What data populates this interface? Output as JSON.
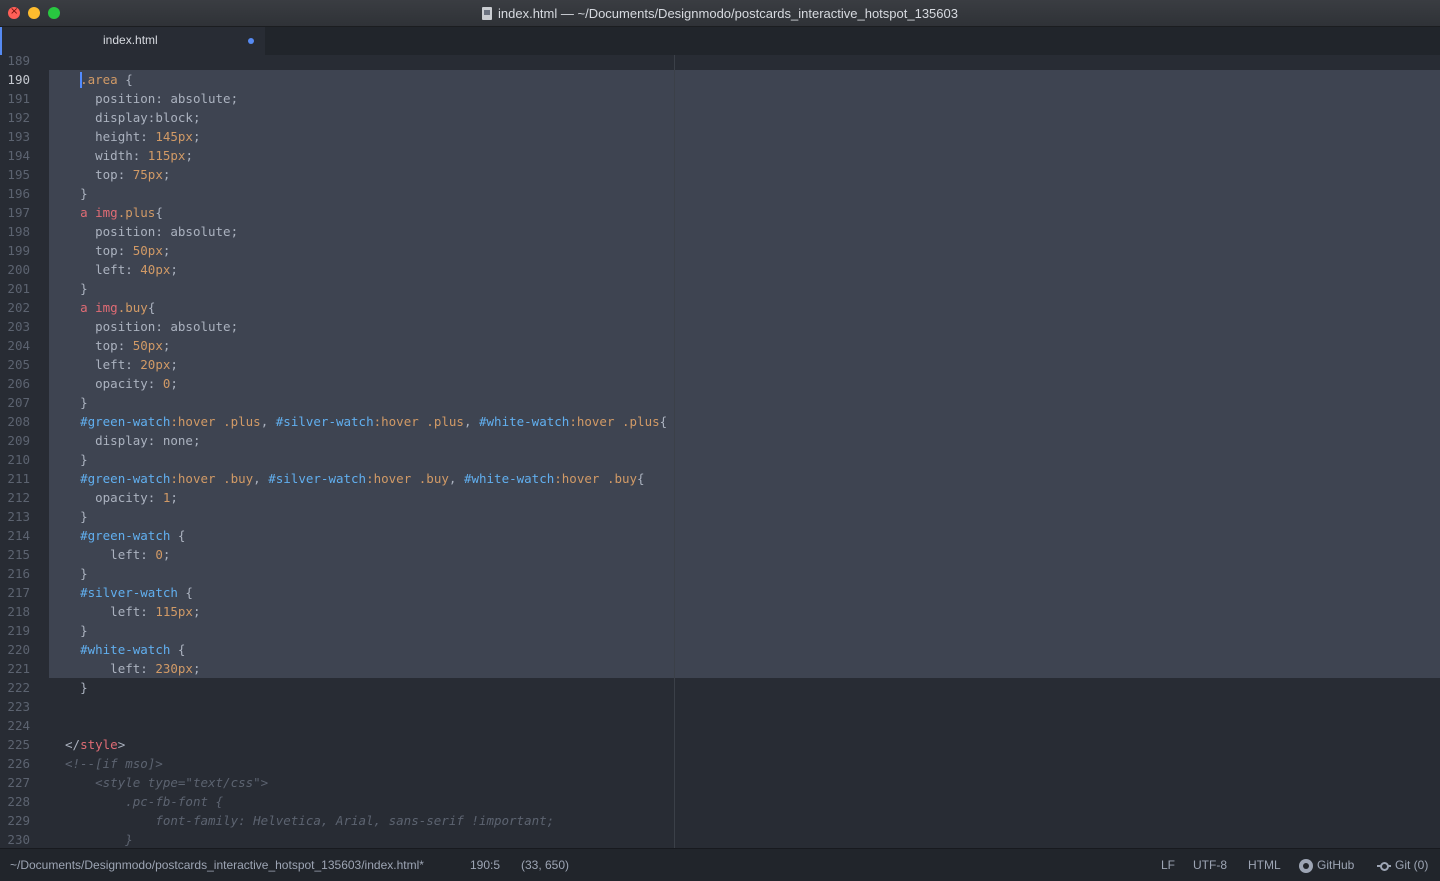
{
  "window": {
    "title": "index.html — ~/Documents/Designmodo/postcards_interactive_hotspot_135603"
  },
  "tab": {
    "label": "index.html"
  },
  "editor": {
    "lines": [
      {
        "n": "189",
        "tokens": []
      },
      {
        "n": "190",
        "tokens": [
          {
            "t": ".area",
            "c": "t-c"
          },
          {
            "t": " {",
            "c": "t-p"
          }
        ]
      },
      {
        "n": "191",
        "tokens": [
          {
            "t": "  position: absolute;",
            "c": "t-p"
          }
        ]
      },
      {
        "n": "192",
        "tokens": [
          {
            "t": "  display:block;",
            "c": "t-p"
          }
        ]
      },
      {
        "n": "193",
        "tokens": [
          {
            "t": "  height: ",
            "c": "t-p"
          },
          {
            "t": "145px",
            "c": "t-n"
          },
          {
            "t": ";",
            "c": "t-p"
          }
        ]
      },
      {
        "n": "194",
        "tokens": [
          {
            "t": "  width: ",
            "c": "t-p"
          },
          {
            "t": "115px",
            "c": "t-n"
          },
          {
            "t": ";",
            "c": "t-p"
          }
        ]
      },
      {
        "n": "195",
        "tokens": [
          {
            "t": "  top: ",
            "c": "t-p"
          },
          {
            "t": "75px",
            "c": "t-n"
          },
          {
            "t": ";",
            "c": "t-p"
          }
        ]
      },
      {
        "n": "196",
        "tokens": [
          {
            "t": "}",
            "c": "t-p"
          }
        ]
      },
      {
        "n": "197",
        "tokens": [
          {
            "t": "a ",
            "c": "t-k"
          },
          {
            "t": "img",
            "c": "t-k"
          },
          {
            "t": ".plus",
            "c": "t-c"
          },
          {
            "t": "{",
            "c": "t-p"
          }
        ]
      },
      {
        "n": "198",
        "tokens": [
          {
            "t": "  position: absolute;",
            "c": "t-p"
          }
        ]
      },
      {
        "n": "199",
        "tokens": [
          {
            "t": "  top: ",
            "c": "t-p"
          },
          {
            "t": "50px",
            "c": "t-n"
          },
          {
            "t": ";",
            "c": "t-p"
          }
        ]
      },
      {
        "n": "200",
        "tokens": [
          {
            "t": "  left: ",
            "c": "t-p"
          },
          {
            "t": "40px",
            "c": "t-n"
          },
          {
            "t": ";",
            "c": "t-p"
          }
        ]
      },
      {
        "n": "201",
        "tokens": [
          {
            "t": "}",
            "c": "t-p"
          }
        ]
      },
      {
        "n": "202",
        "tokens": [
          {
            "t": "a ",
            "c": "t-k"
          },
          {
            "t": "img",
            "c": "t-k"
          },
          {
            "t": ".buy",
            "c": "t-c"
          },
          {
            "t": "{",
            "c": "t-p"
          }
        ]
      },
      {
        "n": "203",
        "tokens": [
          {
            "t": "  position: absolute;",
            "c": "t-p"
          }
        ]
      },
      {
        "n": "204",
        "tokens": [
          {
            "t": "  top: ",
            "c": "t-p"
          },
          {
            "t": "50px",
            "c": "t-n"
          },
          {
            "t": ";",
            "c": "t-p"
          }
        ]
      },
      {
        "n": "205",
        "tokens": [
          {
            "t": "  left: ",
            "c": "t-p"
          },
          {
            "t": "20px",
            "c": "t-n"
          },
          {
            "t": ";",
            "c": "t-p"
          }
        ]
      },
      {
        "n": "206",
        "tokens": [
          {
            "t": "  opacity: ",
            "c": "t-p"
          },
          {
            "t": "0",
            "c": "t-n"
          },
          {
            "t": ";",
            "c": "t-p"
          }
        ]
      },
      {
        "n": "207",
        "tokens": [
          {
            "t": "}",
            "c": "t-p"
          }
        ]
      },
      {
        "n": "208",
        "tokens": [
          {
            "t": "#green-watch",
            "c": "t-i"
          },
          {
            "t": ":hover",
            "c": "t-pc"
          },
          {
            "t": " ",
            "c": "t-p"
          },
          {
            "t": ".plus",
            "c": "t-c"
          },
          {
            "t": ", ",
            "c": "t-p"
          },
          {
            "t": "#silver-watch",
            "c": "t-i"
          },
          {
            "t": ":hover",
            "c": "t-pc"
          },
          {
            "t": " ",
            "c": "t-p"
          },
          {
            "t": ".plus",
            "c": "t-c"
          },
          {
            "t": ", ",
            "c": "t-p"
          },
          {
            "t": "#white-watch",
            "c": "t-i"
          },
          {
            "t": ":hover",
            "c": "t-pc"
          },
          {
            "t": " ",
            "c": "t-p"
          },
          {
            "t": ".plus",
            "c": "t-c"
          },
          {
            "t": "{",
            "c": "t-p"
          }
        ]
      },
      {
        "n": "209",
        "tokens": [
          {
            "t": "  display: none;",
            "c": "t-p"
          }
        ]
      },
      {
        "n": "210",
        "tokens": [
          {
            "t": "}",
            "c": "t-p"
          }
        ]
      },
      {
        "n": "211",
        "tokens": [
          {
            "t": "#green-watch",
            "c": "t-i"
          },
          {
            "t": ":hover",
            "c": "t-pc"
          },
          {
            "t": " ",
            "c": "t-p"
          },
          {
            "t": ".buy",
            "c": "t-c"
          },
          {
            "t": ", ",
            "c": "t-p"
          },
          {
            "t": "#silver-watch",
            "c": "t-i"
          },
          {
            "t": ":hover",
            "c": "t-pc"
          },
          {
            "t": " ",
            "c": "t-p"
          },
          {
            "t": ".buy",
            "c": "t-c"
          },
          {
            "t": ", ",
            "c": "t-p"
          },
          {
            "t": "#white-watch",
            "c": "t-i"
          },
          {
            "t": ":hover",
            "c": "t-pc"
          },
          {
            "t": " ",
            "c": "t-p"
          },
          {
            "t": ".buy",
            "c": "t-c"
          },
          {
            "t": "{",
            "c": "t-p"
          }
        ]
      },
      {
        "n": "212",
        "tokens": [
          {
            "t": "  opacity: ",
            "c": "t-p"
          },
          {
            "t": "1",
            "c": "t-n"
          },
          {
            "t": ";",
            "c": "t-p"
          }
        ]
      },
      {
        "n": "213",
        "tokens": [
          {
            "t": "}",
            "c": "t-p"
          }
        ]
      },
      {
        "n": "214",
        "tokens": [
          {
            "t": "#green-watch",
            "c": "t-i"
          },
          {
            "t": " {",
            "c": "t-p"
          }
        ]
      },
      {
        "n": "215",
        "tokens": [
          {
            "t": "    left: ",
            "c": "t-p"
          },
          {
            "t": "0",
            "c": "t-n"
          },
          {
            "t": ";",
            "c": "t-p"
          }
        ]
      },
      {
        "n": "216",
        "tokens": [
          {
            "t": "}",
            "c": "t-p"
          }
        ]
      },
      {
        "n": "217",
        "tokens": [
          {
            "t": "#silver-watch",
            "c": "t-i"
          },
          {
            "t": " {",
            "c": "t-p"
          }
        ]
      },
      {
        "n": "218",
        "tokens": [
          {
            "t": "    left: ",
            "c": "t-p"
          },
          {
            "t": "115px",
            "c": "t-n"
          },
          {
            "t": ";",
            "c": "t-p"
          }
        ]
      },
      {
        "n": "219",
        "tokens": [
          {
            "t": "}",
            "c": "t-p"
          }
        ]
      },
      {
        "n": "220",
        "tokens": [
          {
            "t": "#white-watch",
            "c": "t-i"
          },
          {
            "t": " {",
            "c": "t-p"
          }
        ]
      },
      {
        "n": "221",
        "tokens": [
          {
            "t": "    left: ",
            "c": "t-p"
          },
          {
            "t": "230px",
            "c": "t-n"
          },
          {
            "t": ";",
            "c": "t-p"
          }
        ]
      },
      {
        "n": "222",
        "tokens": [
          {
            "t": "}",
            "c": "t-p"
          }
        ]
      },
      {
        "n": "223",
        "tokens": []
      },
      {
        "n": "224",
        "tokens": []
      },
      {
        "n": "225",
        "tokens": [
          {
            "t": "</",
            "c": "t-p"
          },
          {
            "t": "style",
            "c": "t-k"
          },
          {
            "t": ">",
            "c": "t-p"
          }
        ]
      },
      {
        "n": "226",
        "tokens": [
          {
            "t": "<!--[if mso]>",
            "c": "t-m"
          }
        ]
      },
      {
        "n": "227",
        "tokens": [
          {
            "t": "  <style type=\"text/css\">",
            "c": "t-m"
          }
        ]
      },
      {
        "n": "228",
        "tokens": [
          {
            "t": "      .pc-fb-font {",
            "c": "t-m"
          }
        ]
      },
      {
        "n": "229",
        "tokens": [
          {
            "t": "          font-family: Helvetica, Arial, sans-serif !important;",
            "c": "t-m"
          }
        ]
      },
      {
        "n": "230",
        "tokens": [
          {
            "t": "      }",
            "c": "t-m"
          }
        ]
      }
    ],
    "current_line": "190"
  },
  "statusbar": {
    "path": "~/Documents/Designmodo/postcards_interactive_hotspot_135603/index.html*",
    "cursor_position": "190:5",
    "selection_info": "(33, 650)",
    "line_ending": "LF",
    "encoding": "UTF-8",
    "grammar": "HTML",
    "github_label": "GitHub",
    "git_label": "Git (0)"
  },
  "colors": {
    "background": "#282c34",
    "selection": "#3e4451",
    "accent": "#568af2"
  }
}
